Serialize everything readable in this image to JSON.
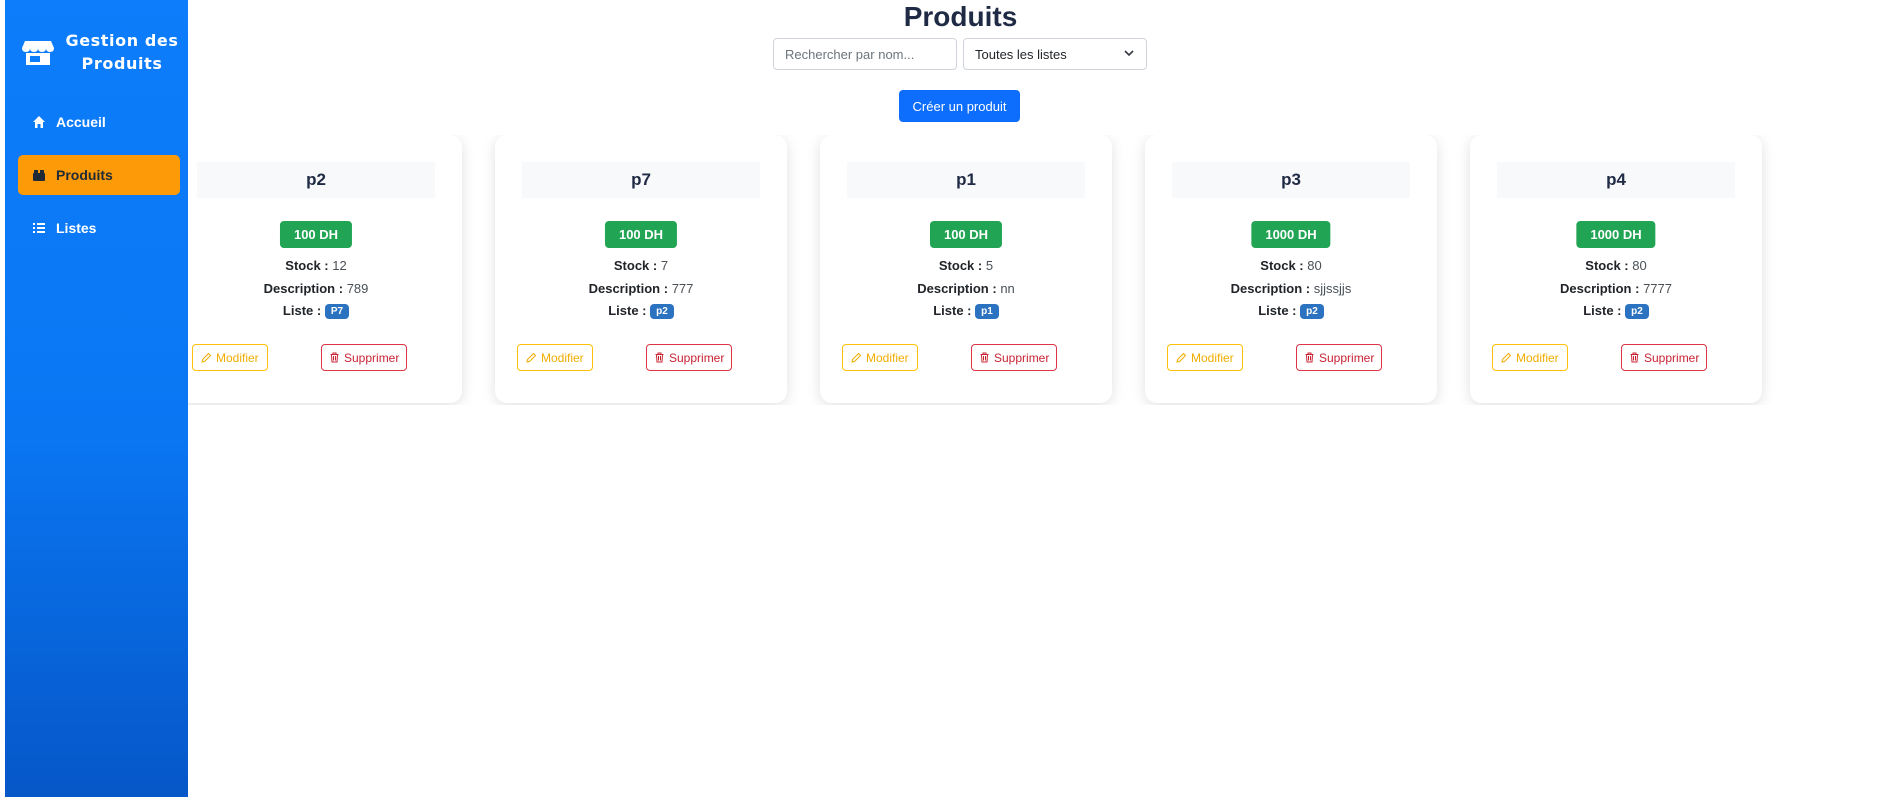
{
  "sidebar": {
    "brand": "Gestion des Produits",
    "brand_icon": "store-icon",
    "items": [
      {
        "label": "Accueil",
        "icon": "home-icon",
        "active": false
      },
      {
        "label": "Produits",
        "icon": "boxes-icon",
        "active": true
      },
      {
        "label": "Listes",
        "icon": "list-icon",
        "active": false
      }
    ]
  },
  "header": {
    "title": "Produits",
    "search_placeholder": "Rechercher par nom...",
    "list_filter_value": "Toutes les listes",
    "create_label": "Créer un produit"
  },
  "card_labels": {
    "stock": "Stock :",
    "description": "Description :",
    "liste": "Liste :",
    "edit": "Modifier",
    "delete": "Supprimer"
  },
  "products": [
    {
      "name": "p2",
      "price": "100 DH",
      "stock": "12",
      "description": "789",
      "liste": "P7"
    },
    {
      "name": "p7",
      "price": "100 DH",
      "stock": "7",
      "description": "777",
      "liste": "p2"
    },
    {
      "name": "p1",
      "price": "100 DH",
      "stock": "5",
      "description": "nn",
      "liste": "p1"
    },
    {
      "name": "p3",
      "price": "1000 DH",
      "stock": "80",
      "description": "sjjssjjs",
      "liste": "p2"
    },
    {
      "name": "p4",
      "price": "1000 DH",
      "stock": "80",
      "description": "7777",
      "liste": "p2"
    }
  ],
  "colors": {
    "sidebar": "#0d7dfb",
    "active_nav": "#fd9a08",
    "primary": "#0d6efd",
    "price": "#22a455",
    "badge": "#2b73c0",
    "edit": "#ffc107",
    "delete": "#dc3545"
  }
}
